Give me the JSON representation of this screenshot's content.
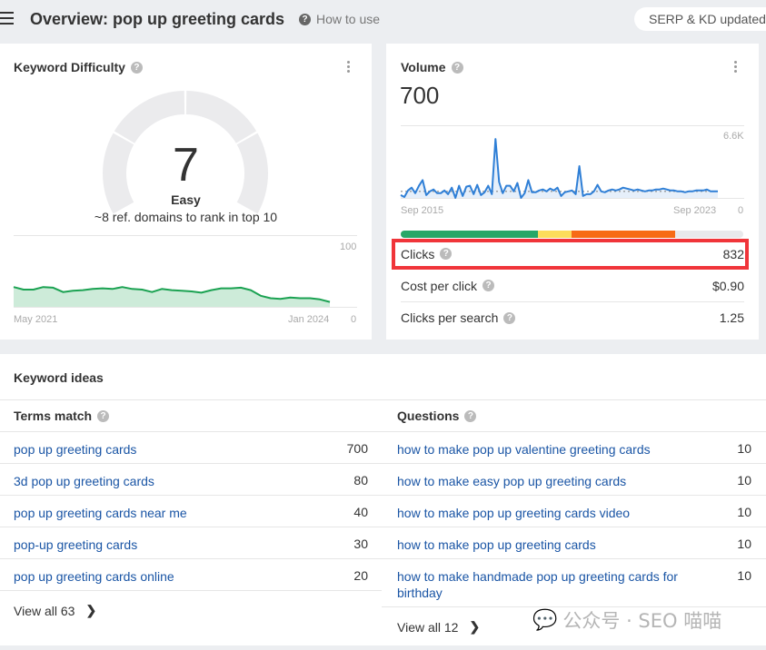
{
  "header": {
    "title": "Overview: pop up greeting cards",
    "how_to_use": "How to use",
    "serp_badge": "SERP & KD updated"
  },
  "kd": {
    "title": "Keyword Difficulty",
    "score": "7",
    "score_value": 7,
    "label": "Easy",
    "subtitle": "~8 ref. domains to rank in top 10",
    "chart": {
      "type": "area",
      "y_max_label": "100",
      "y_min_label": "0",
      "x_start": "May 2021",
      "x_end": "Jan 2024",
      "ylim": [
        0,
        100
      ],
      "values": [
        32,
        28,
        28,
        32,
        31,
        24,
        26,
        27,
        29,
        30,
        29,
        32,
        29,
        28,
        24,
        29,
        27,
        26,
        25,
        23,
        27,
        30,
        30,
        31,
        27,
        18,
        14,
        13,
        15,
        14,
        14,
        12,
        8
      ],
      "color": "#1ba252"
    }
  },
  "volume": {
    "title": "Volume",
    "value": "700",
    "chart": {
      "type": "line",
      "y_max_label": "6.6K",
      "y_min_label": "0",
      "x_start": "Sep 2015",
      "x_end": "Sep 2023",
      "ylim": [
        0,
        6600
      ],
      "avg": 700,
      "color": "#2f7fd6",
      "values": [
        300,
        100,
        800,
        1100,
        500,
        1300,
        1900,
        300,
        700,
        900,
        500,
        500,
        800,
        400,
        1100,
        0,
        1300,
        200,
        1200,
        1300,
        400,
        1400,
        300,
        600,
        1300,
        400,
        6300,
        1700,
        500,
        1300,
        1300,
        700,
        1600,
        0,
        500,
        1900,
        600,
        600,
        800,
        900,
        700,
        1000,
        800,
        1100,
        200,
        600,
        700,
        800,
        400,
        3400,
        200,
        400,
        400,
        700,
        1400,
        700,
        600,
        800,
        900,
        800,
        900,
        1100,
        1000,
        900,
        800,
        900,
        800,
        700,
        800,
        800,
        900,
        900,
        1000,
        900,
        800,
        800,
        700,
        700,
        600,
        700,
        700,
        800,
        800,
        800,
        900,
        700,
        700,
        700
      ],
      "distribution": [
        {
          "fraction": 0.4,
          "color": "#27a767"
        },
        {
          "fraction": 0.1,
          "color": "#fcdc5c"
        },
        {
          "fraction": 0.3,
          "color": "#f76b15"
        },
        {
          "fraction": 0.2,
          "color": "#e8e9eb"
        }
      ]
    },
    "metrics": [
      {
        "label": "Clicks",
        "value": "832"
      },
      {
        "label": "Cost per click",
        "value": "$0.90"
      },
      {
        "label": "Clicks per search",
        "value": "1.25"
      }
    ]
  },
  "ideas": {
    "title": "Keyword ideas",
    "terms": {
      "header": "Terms match",
      "items": [
        {
          "kw": "pop up greeting cards",
          "v": "700"
        },
        {
          "kw": "3d pop up greeting cards",
          "v": "80"
        },
        {
          "kw": "pop up greeting cards near me",
          "v": "40"
        },
        {
          "kw": "pop-up greeting cards",
          "v": "30"
        },
        {
          "kw": "pop up greeting cards online",
          "v": "20"
        }
      ],
      "view_all": "View all 63"
    },
    "questions": {
      "header": "Questions",
      "items": [
        {
          "kw": "how to make pop up valentine greeting cards",
          "v": "10"
        },
        {
          "kw": "how to make easy pop up greeting cards",
          "v": "10"
        },
        {
          "kw": "how to make pop up greeting cards video",
          "v": "10"
        },
        {
          "kw": "how to make pop up greeting cards",
          "v": "10"
        },
        {
          "kw": "how to make handmade pop up greeting cards for birthday",
          "v": "10"
        }
      ],
      "view_all": "View all 12"
    }
  },
  "watermark": "公众号 · SEO 喵喵"
}
